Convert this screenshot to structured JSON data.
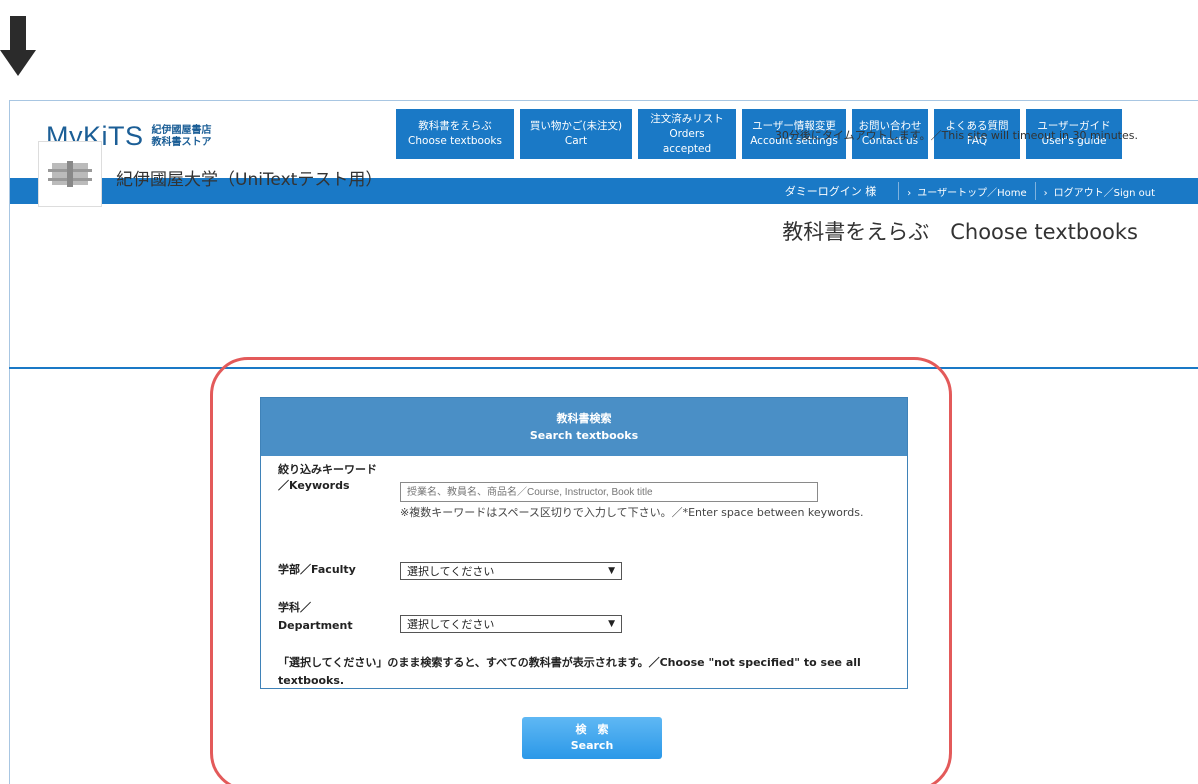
{
  "brand": {
    "logo_main": "MyKiTS",
    "logo_sub_line1": "紀伊國屋書店",
    "logo_sub_line2": "教科書ストア"
  },
  "nav": [
    {
      "jp": "教科書をえらぶ",
      "en": "Choose textbooks"
    },
    {
      "jp": "買い物かご(未注文)",
      "en": "Cart"
    },
    {
      "jp": "注文済みリスト",
      "en": "Orders accepted"
    },
    {
      "jp": "ユーザー情報変更",
      "en": "Account settings"
    },
    {
      "jp": "お問い合わせ",
      "en": "Contact us"
    },
    {
      "jp": "よくある質問",
      "en": "FAQ"
    },
    {
      "jp": "ユーザーガイド",
      "en": "User's guide"
    }
  ],
  "userbar": {
    "user": "ダミーログイン 様",
    "home_link": "ユーザートップ／Home",
    "signout_link": "ログアウト／Sign out"
  },
  "timeout_notice": "30分後にタイムアウトします。／This site will timeout in 30 minutes.",
  "school_name": "紀伊國屋大学（UniTextテスト用）",
  "page_heading": "教科書をえらぶ　Choose textbooks",
  "search_panel": {
    "title_jp": "教科書検索",
    "title_en": "Search textbooks",
    "keywords_label_1": "絞り込みキーワード",
    "keywords_label_2": "／Keywords",
    "keywords_placeholder": "授業名、教員名、商品名／Course, Instructor, Book title",
    "keywords_value": "",
    "keywords_hint": "※複数キーワードはスペース区切りで入力して下さい。／*Enter space between keywords.",
    "faculty_label": "学部／Faculty",
    "faculty_selected": "選択してください",
    "department_label_1": "学科／",
    "department_label_2": "Department",
    "department_selected": "選択してください",
    "note": "「選択してください」のまま検索すると、すべての教科書が表示されます。／Choose \"not specified\" to see all textbooks.",
    "search_button_jp": "検　索",
    "search_button_en": "Search"
  },
  "colors": {
    "brand_blue": "#1a79c6",
    "panel_header": "#4a8fc6",
    "highlight_red": "#e35a5a",
    "button": "#2b98e8"
  }
}
